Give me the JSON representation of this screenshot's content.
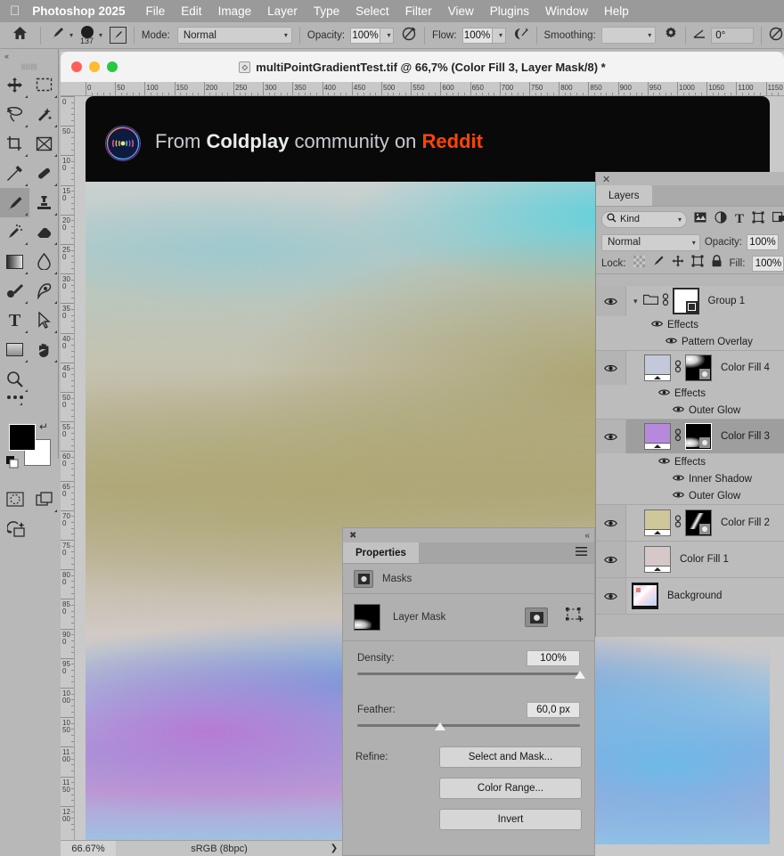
{
  "menubar": {
    "apple_icon": "apple-logo-icon",
    "app_name": "Photoshop 2025",
    "items": [
      "File",
      "Edit",
      "Image",
      "Layer",
      "Type",
      "Select",
      "Filter",
      "View",
      "Plugins",
      "Window",
      "Help"
    ]
  },
  "options_bar": {
    "home_icon": "home-icon",
    "brush_preset_icon": "brush-preset-icon",
    "brush_size": "137",
    "brush_settings_icon": "brush-panel-icon",
    "mode_label": "Mode:",
    "mode_value": "Normal",
    "opacity_label": "Opacity:",
    "opacity_value": "100%",
    "opacity_pressure_icon": "pressure-opacity-icon",
    "flow_label": "Flow:",
    "flow_value": "100%",
    "airbrush_icon": "airbrush-icon",
    "smoothing_label": "Smoothing:",
    "smoothing_value": "",
    "smoothing_gear_icon": "gear-icon",
    "angle_icon": "angle-icon",
    "angle_value": "0°",
    "symmetry_icon": "symmetry-icon"
  },
  "tools": {
    "collapse_icon": "collapse-panel-icon",
    "items": [
      {
        "name": "move-tool",
        "glyph": "move-icon"
      },
      {
        "name": "rectangular-select-tool",
        "glyph": "marquee-icon"
      },
      {
        "name": "lasso-tool",
        "glyph": "lasso-icon"
      },
      {
        "name": "object-select-tool",
        "glyph": "magic-wand-icon"
      },
      {
        "name": "crop-tool",
        "glyph": "crop-icon"
      },
      {
        "name": "frame-tool",
        "glyph": "frame-icon"
      },
      {
        "name": "eyedropper-tool",
        "glyph": "eyedropper-icon"
      },
      {
        "name": "spot-healing-tool",
        "glyph": "healing-icon"
      },
      {
        "name": "brush-tool",
        "glyph": "brush-icon"
      },
      {
        "name": "clone-stamp-tool",
        "glyph": "stamp-icon"
      },
      {
        "name": "history-brush-tool",
        "glyph": "history-brush-icon"
      },
      {
        "name": "eraser-tool",
        "glyph": "eraser-icon"
      },
      {
        "name": "gradient-tool",
        "glyph": "gradient-icon"
      },
      {
        "name": "blur-tool",
        "glyph": "blur-drop-icon"
      },
      {
        "name": "dodge-tool",
        "glyph": "dodge-icon"
      },
      {
        "name": "pen-tool",
        "glyph": "pen-icon"
      },
      {
        "name": "custom-shape-tool",
        "glyph": "shape-icon"
      },
      {
        "name": "type-tool",
        "glyph": "type-icon"
      },
      {
        "name": "path-select-tool",
        "glyph": "path-arrow-icon"
      },
      {
        "name": "rectangle-tool",
        "glyph": "rectangle-icon"
      },
      {
        "name": "hand-tool",
        "glyph": "hand-icon"
      },
      {
        "name": "zoom-tool",
        "glyph": "magnifier-icon"
      },
      {
        "name": "more-tools",
        "glyph": "ellipsis-icon"
      }
    ],
    "selected_tool": "brush-tool",
    "foreground_color": "#000000",
    "background_color": "#ffffff",
    "quick_mask_icon": "quick-mask-icon",
    "screen_mode_icon": "screen-mode-icon",
    "generative_fill_icon": "generative-ai-icon"
  },
  "document": {
    "title": "multiPointGradientTest.tif @ 66,7% (Color Fill 3, Layer Mask/8) *",
    "badge_icon": "photoshop-doc-icon",
    "traffic_lights": [
      "close-button",
      "minimize-button",
      "maximize-button"
    ],
    "ruler_unit_step": 50,
    "ruler_h_labels": [
      "0",
      "50",
      "100",
      "150",
      "200",
      "250",
      "300",
      "350",
      "400",
      "450",
      "500",
      "550",
      "600",
      "650",
      "700",
      "750",
      "800",
      "850",
      "900",
      "950",
      "1000",
      "1050",
      "1100",
      "1150"
    ],
    "ruler_v_labels": [
      "0",
      "50",
      "100",
      "150",
      "200",
      "250",
      "300",
      "350",
      "400",
      "450",
      "500",
      "550",
      "600",
      "650",
      "700",
      "750",
      "800",
      "850",
      "900",
      "950",
      "1000",
      "1050",
      "1100",
      "1150",
      "1200"
    ]
  },
  "banner": {
    "logo_icon": "coldplay-moon-logo-icon",
    "logo_glyph": ")))●((",
    "prefix": "From ",
    "community": "Coldplay",
    "middle": " community on ",
    "platform": "Reddit",
    "platform_color": "#ff4500",
    "background_color": "#0b0b0b"
  },
  "statusbar": {
    "zoom": "66.67%",
    "profile": "sRGB (8bpc)",
    "expand_arrow": "❯"
  },
  "layers_panel": {
    "close_icon": "close-icon",
    "tab_label": "Layers",
    "menu_icon": "panel-menu-icon",
    "filter_icon": "search-icon",
    "filter_value": "Kind",
    "filter_type_icons": [
      "pixel-filter-icon",
      "adjustment-filter-icon",
      "type-filter-icon",
      "shape-filter-icon",
      "smart-object-filter-icon"
    ],
    "blend_mode": "Normal",
    "opacity_label": "Opacity:",
    "opacity_value": "100%",
    "lock_label": "Lock:",
    "lock_icons": [
      "lock-transparency-icon",
      "lock-image-icon",
      "lock-position-icon",
      "lock-artboard-icon",
      "lock-all-icon"
    ],
    "fill_label": "Fill:",
    "fill_value": "100%",
    "layers": [
      {
        "name": "Group 1",
        "kind": "group",
        "visible": true,
        "selected": false,
        "expanded": true,
        "linked": true,
        "effects_label": "Effects",
        "effects": [
          "Pattern Overlay"
        ]
      },
      {
        "name": "Color Fill 4",
        "kind": "fill",
        "visible": true,
        "selected": false,
        "linked": true,
        "swatch": "#c3c9da",
        "effects_label": "Effects",
        "effects": [
          "Outer Glow"
        ]
      },
      {
        "name": "Color Fill 3",
        "kind": "fill",
        "visible": true,
        "selected": true,
        "linked": true,
        "swatch": "#b689dd",
        "effects_label": "Effects",
        "effects": [
          "Inner Shadow",
          "Outer Glow"
        ]
      },
      {
        "name": "Color Fill 2",
        "kind": "fill",
        "visible": true,
        "selected": false,
        "linked": true,
        "swatch": "#cfc69a",
        "effects": []
      },
      {
        "name": "Color Fill 1",
        "kind": "fill",
        "visible": true,
        "selected": false,
        "linked": false,
        "swatch": "#d6c8c8",
        "effects": []
      },
      {
        "name": "Background",
        "kind": "image",
        "visible": true,
        "selected": false,
        "linked": false,
        "effects": []
      }
    ],
    "eye_icon": "eye-visibility-icon",
    "link_icon": "link-icon",
    "folder_icon": "folder-icon",
    "expand_icon": "chevron-down-icon",
    "fx_icon": "fx-icon"
  },
  "properties_panel": {
    "close_icon": "close-icon",
    "collapse_icon": "collapse-double-chevron-icon",
    "tab_label": "Properties",
    "menu_icon": "panel-menu-icon",
    "section_icon": "mask-icon",
    "section_label": "Masks",
    "mask_row_label": "Layer Mask",
    "mask_thumb_icon": "layer-mask-thumbnail",
    "pixel_mask_icon": "pixel-mask-icon",
    "vector_mask_icon": "vector-mask-icon",
    "density_label": "Density:",
    "density_value": "100%",
    "density_percent": 100,
    "feather_label": "Feather:",
    "feather_value": "60,0 px",
    "feather_percent": 37,
    "refine_label": "Refine:",
    "buttons": [
      "Select and Mask...",
      "Color Range...",
      "Invert"
    ]
  }
}
